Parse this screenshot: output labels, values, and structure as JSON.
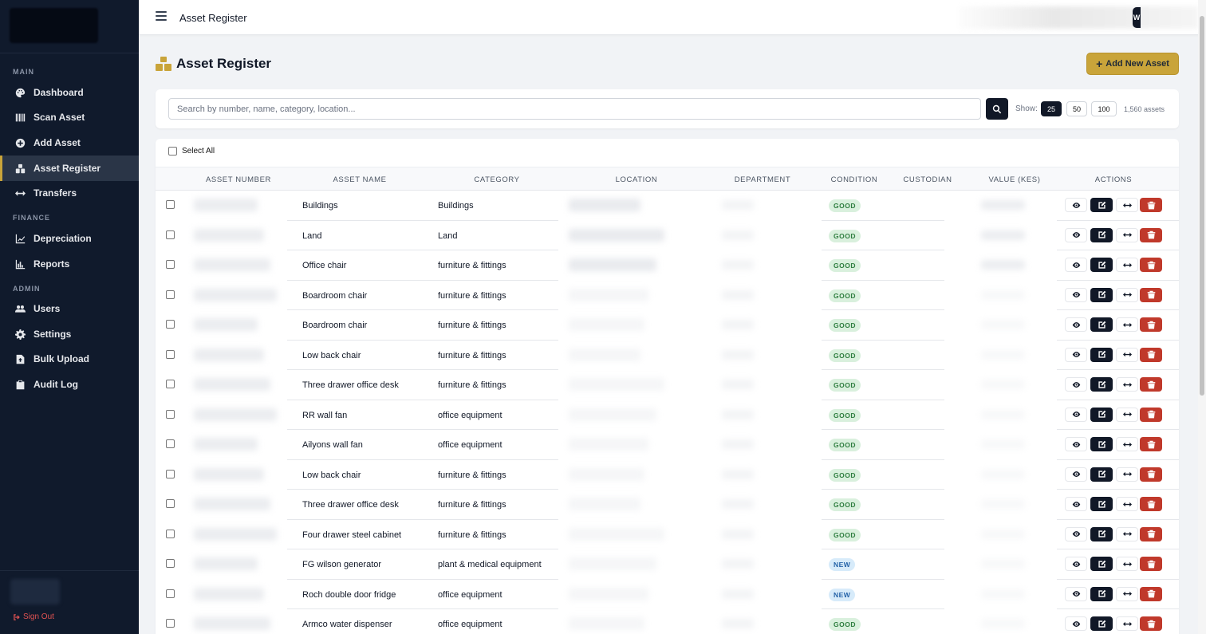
{
  "sidebar": {
    "sections": [
      {
        "label": "MAIN",
        "items": [
          {
            "label": "Dashboard",
            "icon": "palette-icon",
            "active": false
          },
          {
            "label": "Scan Asset",
            "icon": "barcode-icon",
            "active": false
          },
          {
            "label": "Add Asset",
            "icon": "plus-circle-icon",
            "active": false
          },
          {
            "label": "Asset Register",
            "icon": "boxes-icon",
            "active": true
          },
          {
            "label": "Transfers",
            "icon": "arrows-horizontal-icon",
            "active": false
          }
        ]
      },
      {
        "label": "FINANCE",
        "items": [
          {
            "label": "Depreciation",
            "icon": "line-chart-icon",
            "active": false
          },
          {
            "label": "Reports",
            "icon": "bar-chart-icon",
            "active": false
          }
        ]
      },
      {
        "label": "ADMIN",
        "items": [
          {
            "label": "Users",
            "icon": "users-icon",
            "active": false
          },
          {
            "label": "Settings",
            "icon": "gear-icon",
            "active": false
          },
          {
            "label": "Bulk Upload",
            "icon": "file-upload-icon",
            "active": false
          },
          {
            "label": "Audit Log",
            "icon": "clipboard-icon",
            "active": false
          }
        ]
      }
    ],
    "sign_out": "Sign Out"
  },
  "topbar": {
    "title": "Asset Register",
    "user_initial": "W"
  },
  "page": {
    "title": "Asset Register",
    "add_button": "Add New Asset"
  },
  "search": {
    "placeholder": "Search by number, name, category, location...",
    "show_label": "Show:",
    "page_sizes": [
      "25",
      "50",
      "100"
    ],
    "active_page_size": "25",
    "count": "1,560 assets"
  },
  "table": {
    "select_all": "Select All",
    "columns": [
      "ASSET NUMBER",
      "ASSET NAME",
      "CATEGORY",
      "LOCATION",
      "DEPARTMENT",
      "CONDITION",
      "CUSTODIAN",
      "VALUE (KES)",
      "ACTIONS"
    ],
    "rows": [
      {
        "name": "Buildings",
        "category": "Buildings",
        "condition": "GOOD"
      },
      {
        "name": "Land",
        "category": "Land",
        "condition": "GOOD"
      },
      {
        "name": "Office chair",
        "category": "furniture & fittings",
        "condition": "GOOD"
      },
      {
        "name": "Boardroom chair",
        "category": "furniture & fittings",
        "condition": "GOOD"
      },
      {
        "name": "Boardroom chair",
        "category": "furniture & fittings",
        "condition": "GOOD"
      },
      {
        "name": "Low back chair",
        "category": "furniture & fittings",
        "condition": "GOOD"
      },
      {
        "name": "Three drawer office desk",
        "category": "furniture & fittings",
        "condition": "GOOD"
      },
      {
        "name": "RR wall fan",
        "category": "office equipment",
        "condition": "GOOD"
      },
      {
        "name": "Ailyons wall fan",
        "category": "office equipment",
        "condition": "GOOD"
      },
      {
        "name": "Low back chair",
        "category": "furniture & fittings",
        "condition": "GOOD"
      },
      {
        "name": "Three drawer office desk",
        "category": "furniture & fittings",
        "condition": "GOOD"
      },
      {
        "name": "Four drawer steel cabinet",
        "category": "furniture & fittings",
        "condition": "GOOD"
      },
      {
        "name": "FG wilson generator",
        "category": "plant & medical equipment",
        "condition": "NEW"
      },
      {
        "name": "Roch double door fridge",
        "category": "office equipment",
        "condition": "NEW"
      },
      {
        "name": "Armco water dispenser",
        "category": "office equipment",
        "condition": "GOOD"
      }
    ]
  },
  "colors": {
    "sidebar_bg": "#101a2c",
    "accent_gold": "#c9a43a",
    "good_badge": "#d9f0dd",
    "new_badge": "#d7ebfa",
    "delete_red": "#c0392b"
  }
}
